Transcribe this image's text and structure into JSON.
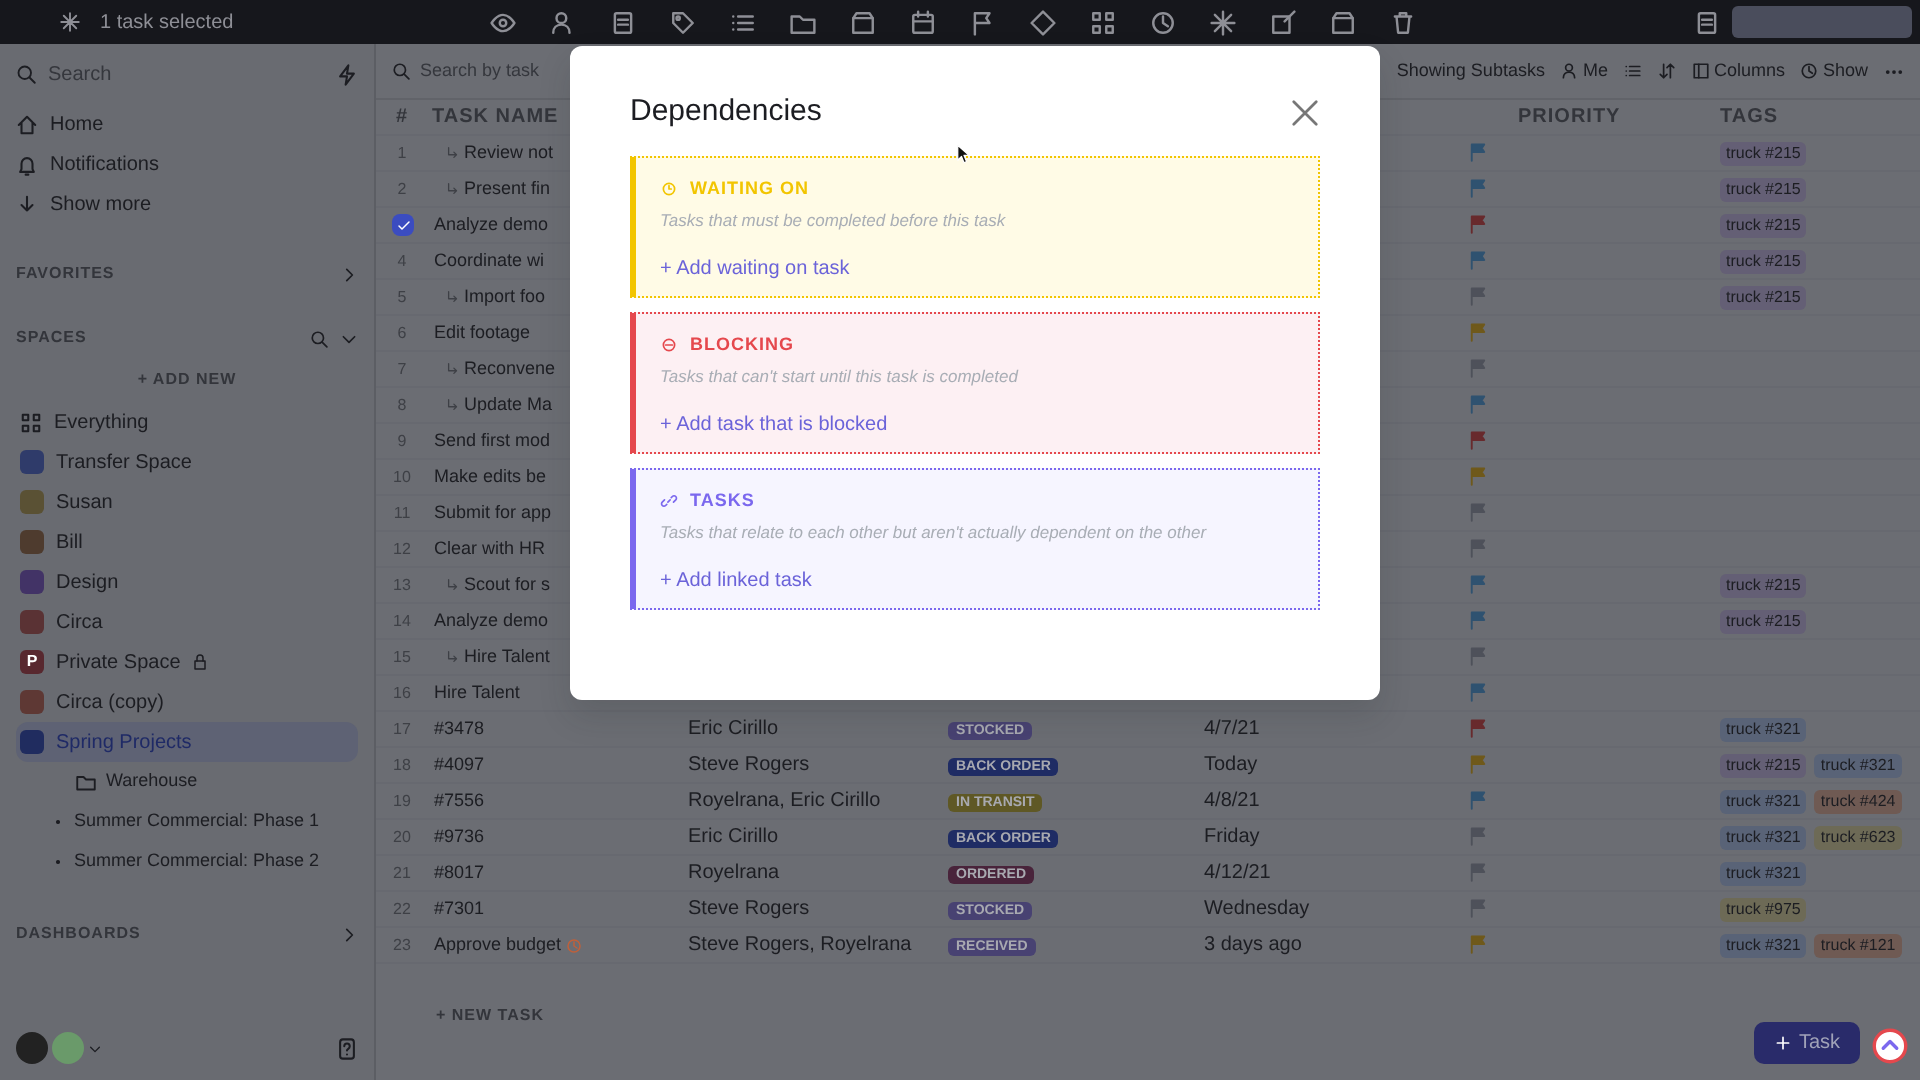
{
  "top_bar": {
    "selection_text": "1 task selected"
  },
  "sidebar": {
    "search": {
      "placeholder": "Search"
    },
    "nav": [
      {
        "label": "Home",
        "kind": "home"
      },
      {
        "label": "Notifications",
        "kind": "bell"
      },
      {
        "label": "Show more",
        "kind": "more"
      }
    ],
    "favorites_heading": "FAVORITES",
    "spaces_heading": "SPACES",
    "add_new": "+ ADD NEW",
    "spaces": [
      {
        "label": "Everything",
        "kind": "all",
        "selected": false,
        "locked": false
      },
      {
        "label": "Transfer Space",
        "kind": "space",
        "color": "#2f3b6a",
        "selected": false,
        "locked": false
      },
      {
        "label": "Susan",
        "kind": "space",
        "color": "#5a5134",
        "selected": false,
        "locked": false
      },
      {
        "label": "Bill",
        "kind": "space",
        "color": "#4e3b2e",
        "selected": false,
        "locked": false
      },
      {
        "label": "Design",
        "kind": "space",
        "color": "#423366",
        "selected": false,
        "locked": false
      },
      {
        "label": "Circa",
        "kind": "space",
        "color": "#5a3234",
        "selected": false,
        "locked": false
      },
      {
        "label": "Private Space",
        "kind": "space",
        "color": "#58282f",
        "letter": "P",
        "selected": false,
        "locked": true
      },
      {
        "label": "Circa (copy)",
        "kind": "space",
        "color": "#5e3834",
        "selected": false,
        "locked": false
      },
      {
        "label": "Spring Projects",
        "kind": "space",
        "color": "#202c5f",
        "selected": true,
        "locked": false,
        "children": [
          {
            "label": "Warehouse",
            "kind": "folder"
          },
          {
            "label": "Summer Commercial: Phase 1",
            "kind": "list"
          },
          {
            "label": "Summer Commercial: Phase 2",
            "kind": "list"
          }
        ]
      }
    ],
    "dashboards_heading": "DASHBOARDS"
  },
  "toolbar": {
    "search": {
      "placeholder": "Search by task"
    },
    "subtasks": "Showing Subtasks",
    "me": "Me",
    "columns": "Columns",
    "show": "Show"
  },
  "table": {
    "columns": [
      "#",
      "TASK NAME",
      "PRIORITY",
      "TAGS"
    ],
    "rows": [
      {
        "number": "1",
        "name": "Review not",
        "subtask": true,
        "checked": false,
        "priority": {
          "color": "#2f5270"
        },
        "tags": [
          {
            "label": "truck #215",
            "color": "#645f75"
          }
        ]
      },
      {
        "number": "2",
        "name": "Present fin",
        "subtask": true,
        "checked": false,
        "priority": {
          "color": "#2f5270"
        },
        "tags": [
          {
            "label": "truck #215",
            "color": "#645f75"
          }
        ]
      },
      {
        "name": "Analyze demo",
        "subtask": false,
        "checked": true,
        "priority": {
          "color": "#682a2d"
        },
        "tags": [
          {
            "label": "truck #215",
            "color": "#645f75"
          }
        ]
      },
      {
        "number": "4",
        "name": "Coordinate wi",
        "subtask": false,
        "checked": false,
        "priority": {
          "color": "#2f5270"
        },
        "tags": [
          {
            "label": "truck #215",
            "color": "#645f75"
          }
        ]
      },
      {
        "number": "5",
        "name": "Import foo",
        "subtask": true,
        "checked": false,
        "priority": {
          "color": "#4e515a"
        },
        "tags": [
          {
            "label": "truck #215",
            "color": "#645f75"
          }
        ]
      },
      {
        "number": "6",
        "name": "Edit footage",
        "subtask": false,
        "checked": false,
        "priority": {
          "color": "#6f591b"
        },
        "tags": []
      },
      {
        "number": "7",
        "name": "Reconvene",
        "subtask": true,
        "checked": false,
        "priority": {
          "color": "#4e515a"
        },
        "tags": []
      },
      {
        "number": "8",
        "name": "Update Ma",
        "subtask": true,
        "checked": false,
        "priority": {
          "color": "#2f5270"
        },
        "tags": []
      },
      {
        "number": "9",
        "name": "Send first mod",
        "subtask": false,
        "checked": false,
        "priority": {
          "color": "#682a2d"
        },
        "tags": []
      },
      {
        "number": "10",
        "name": "Make edits be",
        "subtask": false,
        "checked": false,
        "priority": {
          "color": "#6f591b"
        },
        "tags": []
      },
      {
        "number": "11",
        "name": "Submit for app",
        "subtask": false,
        "checked": false,
        "priority": {
          "color": "#4e515a"
        },
        "tags": []
      },
      {
        "number": "12",
        "name": "Clear with HR",
        "subtask": false,
        "checked": false,
        "priority": {
          "color": "#4e515a"
        },
        "tags": []
      },
      {
        "number": "13",
        "name": "Scout for s",
        "subtask": true,
        "checked": false,
        "priority": {
          "color": "#2f5270"
        },
        "tags": [
          {
            "label": "truck #215",
            "color": "#645f75"
          }
        ]
      },
      {
        "number": "14",
        "name": "Analyze demo",
        "subtask": false,
        "checked": false,
        "priority": {
          "color": "#2f5270"
        },
        "tags": [
          {
            "label": "truck #215",
            "color": "#645f75"
          }
        ]
      },
      {
        "number": "15",
        "name": "Hire Talent",
        "subtask": true,
        "checked": false,
        "priority": {
          "color": "#4e515a"
        },
        "tags": []
      },
      {
        "number": "16",
        "name": "Hire Talent",
        "subtask": false,
        "checked": false,
        "priority": {
          "color": "#2f5270"
        },
        "tags": []
      },
      {
        "number": "17",
        "name": "#3478",
        "subtask": false,
        "checked": false,
        "assignee": "Eric Cirillo",
        "status": {
          "label": "STOCKED",
          "color": "#484272"
        },
        "date": "4/7/21",
        "priority": {
          "color": "#682a2d"
        },
        "tags": [
          {
            "label": "truck #321",
            "color": "#596377"
          }
        ]
      },
      {
        "number": "18",
        "name": "#4097",
        "subtask": false,
        "checked": false,
        "assignee": "Steve Rogers",
        "status": {
          "label": "BACK ORDER",
          "color": "#1f2c64"
        },
        "date": "Today",
        "priority": {
          "color": "#6f591b"
        },
        "tags": [
          {
            "label": "truck #215",
            "color": "#645f75"
          },
          {
            "label": "truck #321",
            "color": "#596377"
          }
        ]
      },
      {
        "number": "19",
        "name": "#7556",
        "subtask": false,
        "checked": false,
        "assignee": "Royelrana, Eric Cirillo",
        "status": {
          "label": "IN TRANSIT",
          "color": "#5f5825"
        },
        "date": "4/8/21",
        "priority": {
          "color": "#2f5270"
        },
        "tags": [
          {
            "label": "truck #321",
            "color": "#596377"
          },
          {
            "label": "truck #424",
            "color": "#6f5a53"
          }
        ]
      },
      {
        "number": "20",
        "name": "#9736",
        "subtask": false,
        "checked": false,
        "assignee": "Eric Cirillo",
        "status": {
          "label": "BACK ORDER",
          "color": "#1f2c64"
        },
        "date": "Friday",
        "priority": {
          "color": "#4e515a"
        },
        "tags": [
          {
            "label": "truck #321",
            "color": "#596377"
          },
          {
            "label": "truck #623",
            "color": "#6d6a56"
          }
        ]
      },
      {
        "number": "21",
        "name": "#8017",
        "subtask": false,
        "checked": false,
        "assignee": "Royelrana",
        "status": {
          "label": "ORDERED",
          "color": "#49243b"
        },
        "date": "4/12/21",
        "priority": {
          "color": "#4e515a"
        },
        "tags": [
          {
            "label": "truck #321",
            "color": "#596377"
          }
        ]
      },
      {
        "number": "22",
        "name": "#7301",
        "subtask": false,
        "checked": false,
        "assignee": "Steve Rogers",
        "status": {
          "label": "STOCKED",
          "color": "#484272"
        },
        "date": "Wednesday",
        "priority": {
          "color": "#4e515a"
        },
        "tags": [
          {
            "label": "truck #975",
            "color": "#6d6a56"
          }
        ]
      },
      {
        "number": "23",
        "name": "Approve budget",
        "subtask": false,
        "checked": false,
        "assignee": "Steve Rogers, Royelrana",
        "status": {
          "label": "RECEIVED",
          "color": "#484272"
        },
        "date": "3 days ago",
        "priority": {
          "color": "#6f591b"
        },
        "tags": [
          {
            "label": "truck #321",
            "color": "#596377"
          },
          {
            "label": "truck #121",
            "color": "#6f5a53"
          }
        ]
      }
    ],
    "new_task": "+ NEW TASK"
  },
  "task_button": "Task",
  "modal": {
    "title": "Dependencies",
    "sections": [
      {
        "kind": "waiting",
        "heading": "WAITING ON",
        "color": "#f2c500",
        "description": "Tasks that must be completed before this task",
        "action": "+ Add waiting on task"
      },
      {
        "kind": "blocking",
        "heading": "BLOCKING",
        "color": "#e5484d",
        "description": "Tasks that can't start until this task is completed",
        "action": "+ Add task that is blocked"
      },
      {
        "kind": "linked",
        "heading": "TASKS",
        "color": "#7b68ee",
        "description": "Tasks that relate to each other but aren't actually dependent on the other",
        "action": "+ Add linked task"
      }
    ]
  }
}
